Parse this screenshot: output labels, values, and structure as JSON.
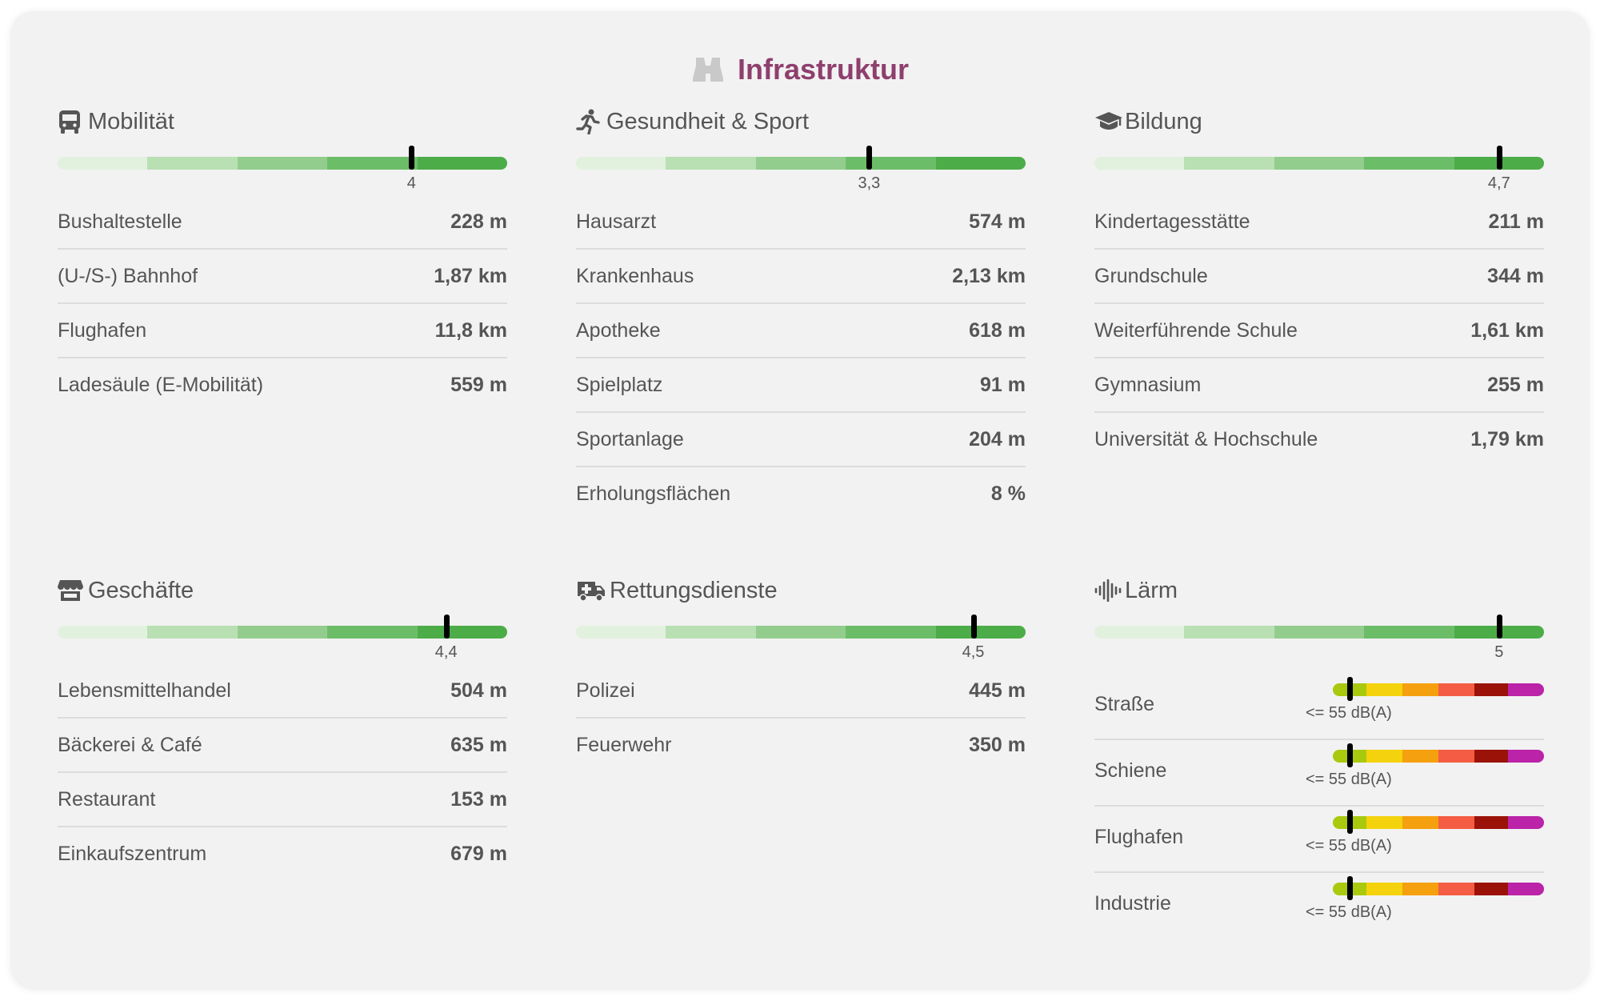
{
  "title": "Infrastruktur",
  "accent_color": "#8e3f6d",
  "rating_scale": [
    0,
    5
  ],
  "sections": {
    "mobilitaet": {
      "title": "Mobilität",
      "icon": "bus-icon",
      "rating": 4,
      "rating_label": "4",
      "items": [
        {
          "label": "Bushaltestelle",
          "value": "228 m"
        },
        {
          "label": "(U-/S-) Bahnhof",
          "value": "1,87 km"
        },
        {
          "label": "Flughafen",
          "value": "11,8 km"
        },
        {
          "label": "Ladesäule (E-Mobilität)",
          "value": "559 m"
        }
      ]
    },
    "gesundheit": {
      "title": "Gesundheit & Sport",
      "icon": "running-person-icon",
      "rating": 3.3,
      "rating_label": "3,3",
      "items": [
        {
          "label": "Hausarzt",
          "value": "574 m"
        },
        {
          "label": "Krankenhaus",
          "value": "2,13 km"
        },
        {
          "label": "Apotheke",
          "value": "618 m"
        },
        {
          "label": "Spielplatz",
          "value": "91 m"
        },
        {
          "label": "Sportanlage",
          "value": "204 m"
        },
        {
          "label": "Erholungsflächen",
          "value": "8 %"
        }
      ]
    },
    "bildung": {
      "title": "Bildung",
      "icon": "graduation-cap-icon",
      "rating": 4.7,
      "rating_label": "4,7",
      "items": [
        {
          "label": "Kindertagesstätte",
          "value": "211 m"
        },
        {
          "label": "Grundschule",
          "value": "344 m"
        },
        {
          "label": "Weiterführende Schule",
          "value": "1,61 km"
        },
        {
          "label": "Gymnasium",
          "value": "255 m"
        },
        {
          "label": "Universität & Hochschule",
          "value": "1,79 km"
        }
      ]
    },
    "geschaefte": {
      "title": "Geschäfte",
      "icon": "store-icon",
      "rating": 4.4,
      "rating_label": "4,4",
      "items": [
        {
          "label": "Lebensmittelhandel",
          "value": "504 m"
        },
        {
          "label": "Bäckerei & Café",
          "value": "635 m"
        },
        {
          "label": "Restaurant",
          "value": "153 m"
        },
        {
          "label": "Einkaufszentrum",
          "value": "679 m"
        }
      ]
    },
    "rettung": {
      "title": "Rettungsdienste",
      "icon": "ambulance-icon",
      "rating": 4.5,
      "rating_label": "4,5",
      "items": [
        {
          "label": "Polizei",
          "value": "445 m"
        },
        {
          "label": "Feuerwehr",
          "value": "350 m"
        }
      ]
    },
    "laerm": {
      "title": "Lärm",
      "icon": "sound-wave-icon",
      "rating": 5,
      "rating_label": "5",
      "noise_colors": [
        "#a9c90f",
        "#f4d20d",
        "#f5a00e",
        "#f45d43",
        "#9b1208",
        "#bb23a8"
      ],
      "items": [
        {
          "label": "Straße",
          "level_label": "<= 55 dB(A)",
          "level_fraction": 0.08
        },
        {
          "label": "Schiene",
          "level_label": "<= 55 dB(A)",
          "level_fraction": 0.08
        },
        {
          "label": "Flughafen",
          "level_label": "<= 55 dB(A)",
          "level_fraction": 0.08
        },
        {
          "label": "Industrie",
          "level_label": "<= 55 dB(A)",
          "level_fraction": 0.08
        }
      ]
    }
  }
}
